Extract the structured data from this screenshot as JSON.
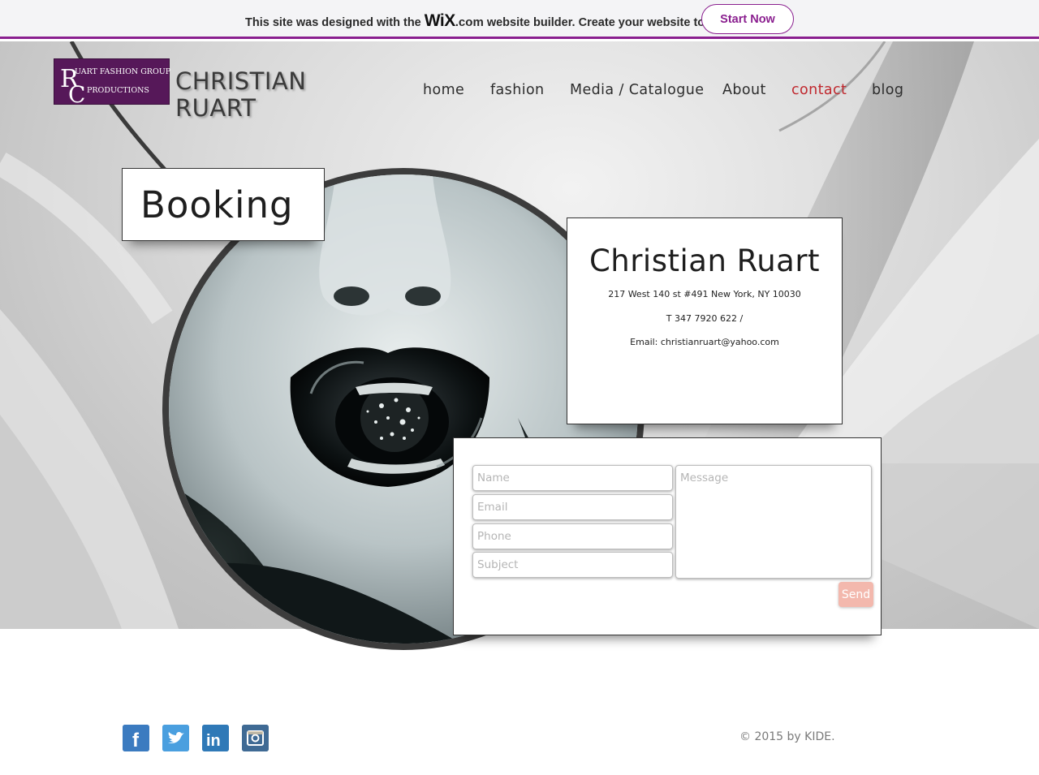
{
  "wix_banner": {
    "text_before": "This site was designed with the",
    "logo": "WiX",
    "dotcom": ".com",
    "text_after": "website builder. Create your website today.",
    "cta_label": "Start Now",
    "accent_color": "#8a1f8f"
  },
  "header": {
    "logo_top_line": "UART FASHION GROUP",
    "logo_bottom_line": "PRODUCTIONS",
    "logo_monogram": "RC",
    "brand_line1": "CHRISTIAN",
    "brand_line2": "RUART"
  },
  "nav": {
    "items": [
      {
        "label": "home",
        "active": false
      },
      {
        "label": "fashion",
        "active": false
      },
      {
        "label": "Media / Catalogue",
        "active": false
      },
      {
        "label": "About",
        "active": false
      },
      {
        "label": "contact",
        "active": true
      },
      {
        "label": "blog",
        "active": false
      }
    ],
    "active_color": "#c0282e"
  },
  "page": {
    "title": "Booking"
  },
  "contact_card": {
    "name": "Christian Ruart",
    "address": "217 West 140 st  #491 New York, NY 10030",
    "phone": "T 347 7920 622 /",
    "email": "Email: christianruart@yahoo.com"
  },
  "form": {
    "name_placeholder": "Name",
    "email_placeholder": "Email",
    "phone_placeholder": "Phone",
    "subject_placeholder": "Subject",
    "message_placeholder": "Message",
    "send_label": "Send",
    "send_color": "#f3b8ad"
  },
  "footer": {
    "social": [
      {
        "icon": "facebook-icon",
        "glyph": "f",
        "color": "#3b7bc0"
      },
      {
        "icon": "twitter-icon",
        "glyph": "t",
        "color": "#4a9fdf"
      },
      {
        "icon": "linkedin-icon",
        "glyph": "in",
        "color": "#2f79b7"
      },
      {
        "icon": "instagram-icon",
        "glyph": "",
        "color": "#3f6a94"
      }
    ],
    "copyright": "© 2015 by KIDE."
  }
}
